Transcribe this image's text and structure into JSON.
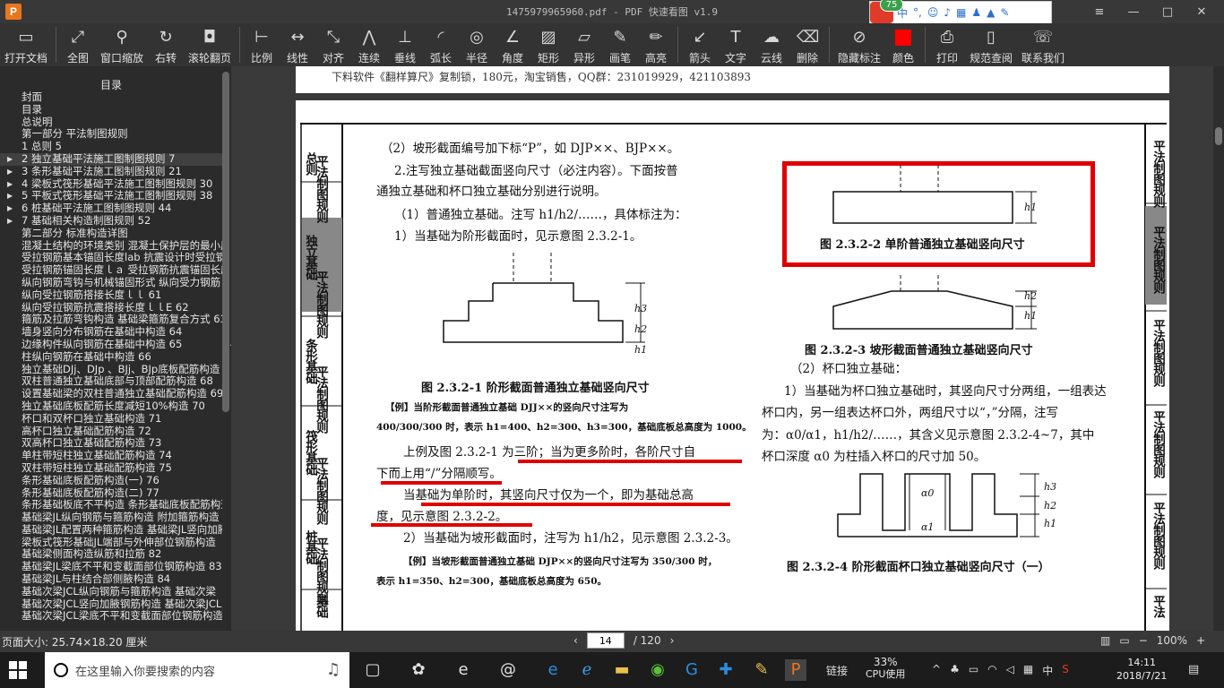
{
  "window": {
    "title": "1475979965960.pdf - PDF 快速看图 v1.9",
    "logo": "P",
    "buttons": {
      "menu": "≡",
      "minimize": "—",
      "maximize": "□",
      "close": "✕"
    }
  },
  "ime": {
    "badge": "75"
  },
  "toolbar": {
    "items": [
      {
        "label": "打开文档",
        "icon": "folder-icon"
      },
      {
        "label": "全图",
        "icon": "fullview-icon"
      },
      {
        "label": "窗口缩放",
        "icon": "zoom-icon"
      },
      {
        "label": "右转",
        "icon": "rotate-icon"
      },
      {
        "label": "滚轮翻页",
        "icon": "mouse-icon"
      },
      {
        "label": "比例",
        "icon": "scale-icon"
      },
      {
        "label": "线性",
        "icon": "linear-icon"
      },
      {
        "label": "对齐",
        "icon": "align-icon"
      },
      {
        "label": "连续",
        "icon": "continuous-icon"
      },
      {
        "label": "垂线",
        "icon": "perpendicular-icon"
      },
      {
        "label": "弧长",
        "icon": "arc-icon"
      },
      {
        "label": "半径",
        "icon": "radius-icon"
      },
      {
        "label": "角度",
        "icon": "angle-icon"
      },
      {
        "label": "矩形",
        "icon": "rectangle-icon"
      },
      {
        "label": "异形",
        "icon": "polygon-icon"
      },
      {
        "label": "画笔",
        "icon": "pen-icon"
      },
      {
        "label": "高亮",
        "icon": "highlight-icon"
      },
      {
        "label": "箭头",
        "icon": "arrow-icon"
      },
      {
        "label": "文字",
        "icon": "text-icon"
      },
      {
        "label": "云线",
        "icon": "cloud-icon"
      },
      {
        "label": "删除",
        "icon": "eraser-icon"
      },
      {
        "label": "隐藏标注",
        "icon": "hide-icon"
      },
      {
        "label": "颜色",
        "icon": "color-icon"
      },
      {
        "label": "打印",
        "icon": "print-icon"
      },
      {
        "label": "规范查阅",
        "icon": "book-icon"
      },
      {
        "label": "联系我们",
        "icon": "contact-icon"
      }
    ]
  },
  "sidebar": {
    "title": "目录",
    "items": [
      {
        "label": "封面",
        "expand": false
      },
      {
        "label": "目录",
        "expand": false
      },
      {
        "label": "总说明",
        "expand": false
      },
      {
        "label": "第一部分  平法制图规则",
        "expand": false
      },
      {
        "label": "1 总则 5",
        "expand": false
      },
      {
        "label": "2 独立基础平法施工图制图规则 7",
        "expand": true,
        "selected": true
      },
      {
        "label": "3 条形基础平法施工图制图规则 21",
        "expand": true
      },
      {
        "label": "4 梁板式筏形基础平法施工图制图规则 30",
        "expand": true
      },
      {
        "label": "5 平板式筏形基础平法施工图制图规则 38",
        "expand": true
      },
      {
        "label": "6 桩基础平法施工图制图规则 44",
        "expand": true
      },
      {
        "label": "7 基础相关构造制图规则 52",
        "expand": true
      },
      {
        "label": "第二部分  标准构造详图",
        "expand": false
      },
      {
        "label": "混凝土结构的环境类别 混凝土保护层的最小厚度",
        "expand": false
      },
      {
        "label": "受拉钢筋基本锚固长度lab 抗震设计时受拉钢筋",
        "expand": false
      },
      {
        "label": "受拉钢筋锚固长度ｌａ 受拉钢筋抗震锚固长度",
        "expand": false
      },
      {
        "label": "纵向钢筋弯钩与机械锚固形式  纵向受力钢筋",
        "expand": false
      },
      {
        "label": "纵向受拉钢筋搭接长度ｌｌ 61",
        "expand": false
      },
      {
        "label": "纵向受拉钢筋抗震搭接长度ｌｌE 62",
        "expand": false
      },
      {
        "label": "箍筋及拉筋弯钩构造  基础梁箍筋复合方式 63",
        "expand": false
      },
      {
        "label": "墙身竖向分布钢筋在基础中构造 64",
        "expand": false
      },
      {
        "label": "边缘构件纵向钢筋在基础中构造 65",
        "expand": false
      },
      {
        "label": "柱纵向钢筋在基础中构造 66",
        "expand": false
      },
      {
        "label": "独立基础DJj、DJp 、BJj、BJp底板配筋构造 67",
        "expand": false
      },
      {
        "label": "双柱普通独立基础底部与顶部配筋构造 68",
        "expand": false
      },
      {
        "label": "设置基础梁的双柱普通独立基础配筋构造 69",
        "expand": false
      },
      {
        "label": "独立基础底板配筋长度减短10%构造 70",
        "expand": false
      },
      {
        "label": "杯口和双杯口独立基础构造 71",
        "expand": false
      },
      {
        "label": "高杯口独立基础配筋构造 72",
        "expand": false
      },
      {
        "label": "双高杯口独立基础配筋构造 73",
        "expand": false
      },
      {
        "label": "单柱带短柱独立基础配筋构造 74",
        "expand": false
      },
      {
        "label": "双柱带短柱独立基础配筋构造 75",
        "expand": false
      },
      {
        "label": "条形基础底板配筋构造(一) 76",
        "expand": false
      },
      {
        "label": "条形基础底板配筋构造(二) 77",
        "expand": false
      },
      {
        "label": "条形基础板底不平构造  条形基础底板配筋构造",
        "expand": false
      },
      {
        "label": "基础梁JL纵向钢筋与箍筋构造  附加箍筋构造",
        "expand": false
      },
      {
        "label": "基础梁JL配置两种箍筋构造  基础梁JL竖向加腋",
        "expand": false
      },
      {
        "label": "梁板式筏形基础JL端部与外伸部位钢筋构造",
        "expand": false
      },
      {
        "label": "基础梁侧面构造纵筋和拉筋 82",
        "expand": false
      },
      {
        "label": "基础梁JL梁底不平和变截面部位钢筋构造 83",
        "expand": false
      },
      {
        "label": "基础梁JL与柱结合部侧腋构造 84",
        "expand": false
      },
      {
        "label": "基础次梁JCL纵向钢筋与箍筋构造  基础次梁",
        "expand": false
      },
      {
        "label": "基础次梁JCL竖向加腋钢筋构造  基础次梁JCL",
        "expand": false
      },
      {
        "label": "基础次梁JCL梁底不平和变截面部位钢筋构造",
        "expand": false
      }
    ]
  },
  "document": {
    "header_text": "下料软件《翻样算尺》复制锁，180元，淘宝销售，QQ群：231019929，421103893",
    "left_tabs": [
      "总则",
      "平法制图规则",
      "独立基础",
      "平法制图规则",
      "条形基础",
      "平法制图规则",
      "筏形基础",
      "平法制图规则",
      "桩基础",
      "平法制图规则",
      "基础"
    ],
    "right_tabs": [
      "平法制图规则",
      "平法制图规则",
      "平法制图规则",
      "平法制图规则",
      "平法制图规则",
      "平法"
    ],
    "left_col": [
      "（2）坡形截面编号加下标“P”，如 DJP××、BJP××。",
      "2.注写独立基础截面竖向尺寸（必注内容）。下面按普",
      "通独立基础和杯口独立基础分别进行说明。",
      "（1）普通独立基础。注写 h1/h2/……，具体标注为：",
      "1）当基础为阶形截面时，见示意图 2.3.2-1。"
    ],
    "fig1_caption": "图 2.3.2-1  阶形截面普通独立基础竖向尺寸",
    "example1": [
      "【例】当阶形截面普通独立基础 DJJ××的竖向尺寸注写为",
      "400/300/300 时，表示 h1=400、h2=300、h3=300，基础底板总高度为 1000。"
    ],
    "para2": [
      "上例及图 2.3.2-1 为三阶；当为更多阶时，各阶尺寸自",
      "下而上用“/”分隔顺写。",
      "当基础为单阶时，其竖向尺寸仅为一个，即为基础总高",
      "度，见示意图 2.3.2-2。",
      "2）当基础为坡形截面时，注写为 h1/h2，见示意图 2.3.2-3。"
    ],
    "example2": [
      "【例】当坡形截面普通独立基础 DJP××的竖向尺寸注写为 350/300 时，",
      "表示 h1=350、h2=300，基础底板总高度为 650。"
    ],
    "fig2_caption": "图 2.3.2-2  单阶普通独立基础竖向尺寸",
    "fig3_caption": "图 2.3.2-3  坡形截面普通独立基础竖向尺寸",
    "right_col": [
      "（2）杯口独立基础：",
      "1）当基础为杯口独立基础时，其竖向尺寸分两组，一组表达",
      "杯口内，另一组表达杯口外，两组尺寸以“，”分隔，注写",
      "为：α0/α1，h1/h2/……，其含义见示意图 2.3.2-4~7，其中",
      "杯口深度 α0 为柱插入杯口的尺寸加 50。"
    ],
    "fig4_caption": "图 2.3.2-4  阶形截面杯口独立基础竖向尺寸（一）",
    "dim_labels": {
      "h1": "h1",
      "h2": "h2",
      "h3": "h3",
      "a0": "α0",
      "a1": "α1"
    }
  },
  "status": {
    "page_size": "页面大小: 25.74×18.20 厘米",
    "current_page": "14",
    "total_pages": "/ 120",
    "zoom": "100%"
  },
  "taskbar": {
    "search_placeholder": "在这里输入你要搜索的内容",
    "tray_text": "链接",
    "cpu_percent": "33%",
    "cpu_label": "CPU使用",
    "ime_lang": "中",
    "time": "14:11",
    "date": "2018/7/21"
  }
}
